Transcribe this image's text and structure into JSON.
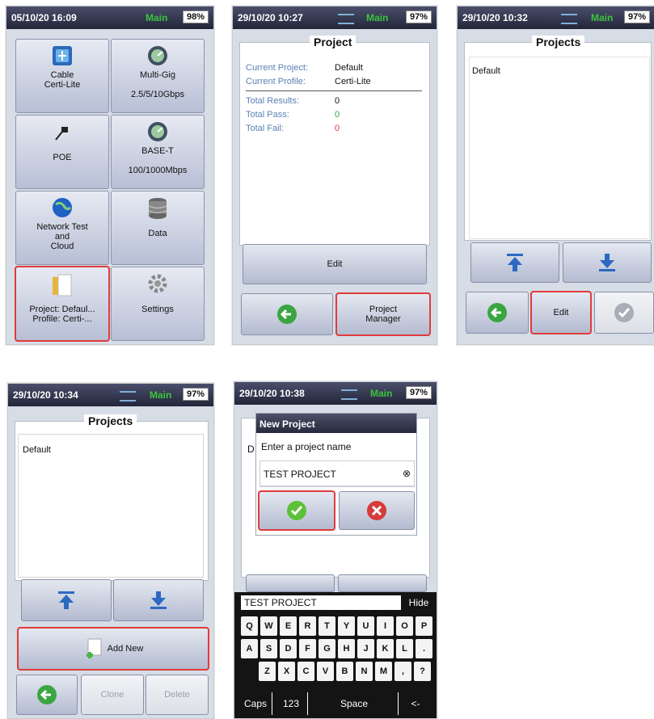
{
  "screen1": {
    "status": {
      "datetime": "05/10/20 16:09",
      "mode": "Main",
      "battery": "98%"
    },
    "tiles": [
      {
        "line1": "Cable",
        "line2": "Certi-Lite"
      },
      {
        "line1": "Multi-Gig",
        "line2": "2.5/5/10Gbps"
      },
      {
        "line1": "POE"
      },
      {
        "line1": "BASE-T",
        "line2": "100/1000Mbps"
      },
      {
        "line1": "Network Test",
        "line2": "and",
        "line3": "Cloud"
      },
      {
        "line1": "Data"
      },
      {
        "line1": "Project: Defaul...",
        "line2": "Profile: Certi-..."
      },
      {
        "line1": "Settings"
      }
    ]
  },
  "screen2": {
    "status": {
      "datetime": "29/10/20 10:27",
      "mode": "Main",
      "battery": "97%"
    },
    "title": "Project",
    "current_project_label": "Current Project:",
    "current_project": "Default",
    "current_profile_label": "Current Profile:",
    "current_profile": "Certi-Lite",
    "total_results_label": "Total Results:",
    "total_results": "0",
    "total_pass_label": "Total Pass:",
    "total_pass": "0",
    "total_fail_label": "Total Fail:",
    "total_fail": "0",
    "edit_label": "Edit",
    "pm_line1": "Project",
    "pm_line2": "Manager"
  },
  "screen3": {
    "status": {
      "datetime": "29/10/20 10:32",
      "mode": "Main",
      "battery": "97%"
    },
    "title": "Projects",
    "items": [
      "Default"
    ],
    "edit_label": "Edit"
  },
  "screen4": {
    "status": {
      "datetime": "29/10/20 10:34",
      "mode": "Main",
      "battery": "97%"
    },
    "title": "Projects",
    "items": [
      "Default"
    ],
    "add_new_label": "Add New",
    "clone_label": "Clone",
    "delete_label": "Delete"
  },
  "screen5": {
    "status": {
      "datetime": "29/10/20 10:38",
      "mode": "Main",
      "battery": "97%"
    },
    "dialog_title": "New Project",
    "bg_letter": "D",
    "prompt": "Enter a project name",
    "input_value": "TEST PROJECT",
    "kbd_input": "TEST PROJECT",
    "hide_label": "Hide",
    "row1": [
      "Q",
      "W",
      "E",
      "R",
      "T",
      "Y",
      "U",
      "I",
      "O",
      "P"
    ],
    "row2": [
      "A",
      "S",
      "D",
      "F",
      "G",
      "H",
      "J",
      "K",
      "L",
      "."
    ],
    "row3": [
      "Z",
      "X",
      "C",
      "V",
      "B",
      "N",
      "M",
      ",",
      "?"
    ],
    "caps_label": "Caps",
    "num_label": "123",
    "space_label": "Space",
    "back_label": "<-"
  },
  "colors": {
    "highlight": "#e03b3b",
    "pass": "#2fa83a",
    "fail": "#d83a3a",
    "main": "#3cc43c"
  }
}
